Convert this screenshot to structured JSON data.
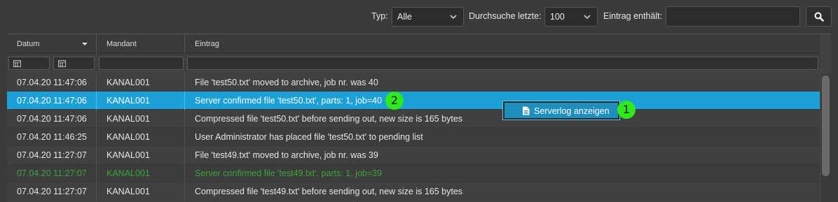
{
  "toolbar": {
    "type_label": "Typ:",
    "type_value": "Alle",
    "range_label": "Durchsuche letzte:",
    "range_value": "100",
    "contains_label": "Eintrag enthält:",
    "contains_value": "",
    "search_icon": "search-icon"
  },
  "grid": {
    "columns": [
      "Datum",
      "Mandant",
      "Eintrag"
    ],
    "rows": [
      {
        "datum": "07.04.20 11:47:06",
        "mandant": "KANAL001",
        "eintrag": "File 'test50.txt' moved to archive, job nr. was 40"
      },
      {
        "datum": "07.04.20 11:47:06",
        "mandant": "KANAL001",
        "eintrag": "Server confirmed file 'test50.txt', parts: 1, job=40"
      },
      {
        "datum": "07.04.20 11:47:06",
        "mandant": "KANAL001",
        "eintrag": "Compressed file 'test50.txt' before sending out, new size is 165 bytes"
      },
      {
        "datum": "07.04.20 11:46:25",
        "mandant": "KANAL001",
        "eintrag": "User Administrator has placed file 'test50.txt' to pending list"
      },
      {
        "datum": "07.04.20 11:27:07",
        "mandant": "KANAL001",
        "eintrag": "File 'test49.txt' moved to archive, job nr. was 39"
      },
      {
        "datum": "07.04.20 11:27:07",
        "mandant": "KANAL001",
        "eintrag": "Server confirmed file 'test49.txt', parts: 1, job=39"
      },
      {
        "datum": "07.04.20 11:27:07",
        "mandant": "KANAL001",
        "eintrag": "Compressed file 'test49.txt' before sending out, new size is 165 bytes"
      }
    ],
    "selected_row": 1,
    "green_row": 5
  },
  "context_menu": {
    "label": "Serverlog anzeigen",
    "icon": "document-icon"
  },
  "markers": {
    "m1": "1",
    "m2": "2"
  },
  "colors": {
    "selection": "#1ba0d8",
    "success_text": "#3aa53a",
    "marker": "#2eea1a"
  }
}
